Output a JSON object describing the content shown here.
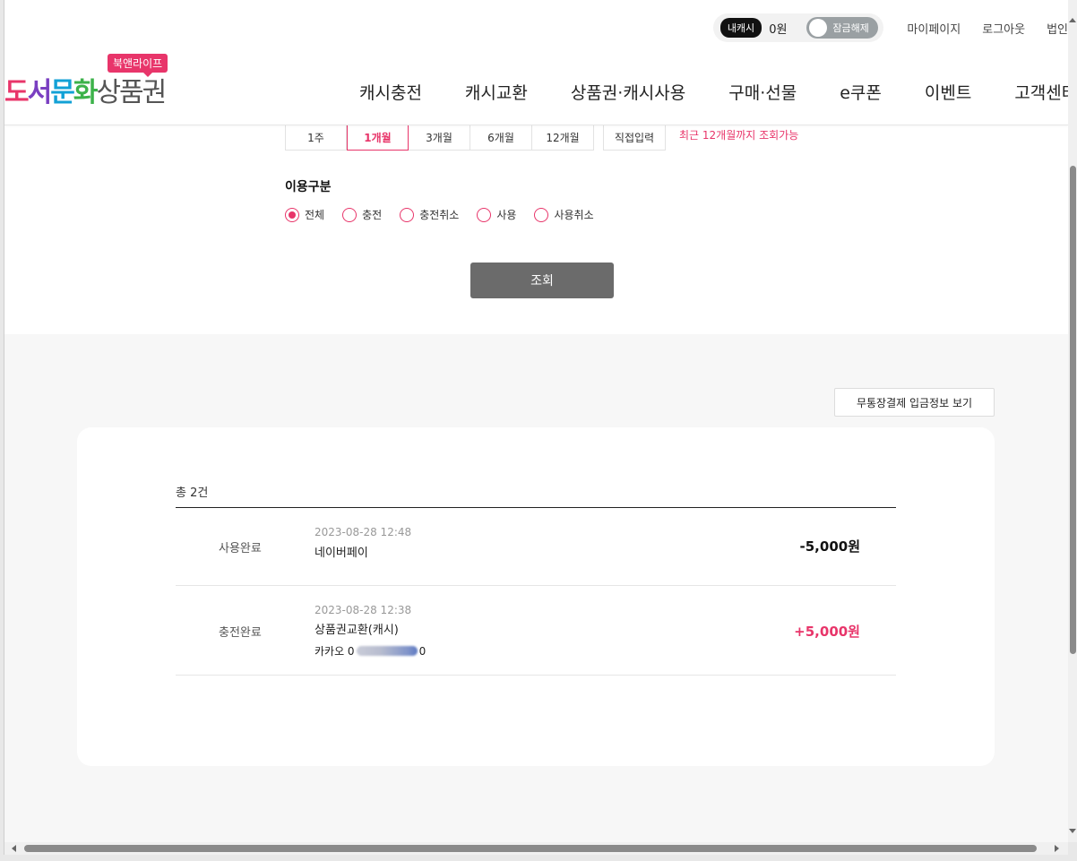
{
  "header": {
    "cash_tag": "내캐시",
    "cash_amount": "0원",
    "lock_toggle_label": "잠금해제",
    "util_links": [
      "마이페이지",
      "로그아웃",
      "법인"
    ],
    "logo": {
      "badge": "북앤라이프",
      "parts": [
        "도",
        "서",
        "문",
        "화",
        "상품권"
      ]
    },
    "nav": [
      "캐시충전",
      "캐시교환",
      "상품권·캐시사용",
      "구매·선물",
      "e쿠폰",
      "이벤트",
      "고객센터"
    ]
  },
  "filter": {
    "periods": [
      "1주",
      "1개월",
      "3개월",
      "6개월",
      "12개월"
    ],
    "active_period": "1개월",
    "custom_input": "직접입력",
    "period_note": "최근 12개월까지 조회가능",
    "type_title": "이용구분",
    "types": [
      "전체",
      "충전",
      "충전취소",
      "사용",
      "사용취소"
    ],
    "selected_type": "전체",
    "search_button": "조회"
  },
  "results": {
    "bank_info_button": "무통장결제 입금정보 보기",
    "total": "총 2건",
    "rows": [
      {
        "status": "사용완료",
        "datetime": "2023-08-28 12:48",
        "title": "네이버페이",
        "amount": "-5,000원"
      },
      {
        "status": "충전완료",
        "datetime": "2023-08-28 12:38",
        "title": "상품권교환(캐시)",
        "sub_prefix": "카카오 0",
        "sub_suffix": "0",
        "amount": "+5,000원"
      }
    ]
  },
  "colors": {
    "accent": "#e8356a",
    "button_gray": "#6b6b6b",
    "toggle_gray": "#9aa0a3"
  }
}
